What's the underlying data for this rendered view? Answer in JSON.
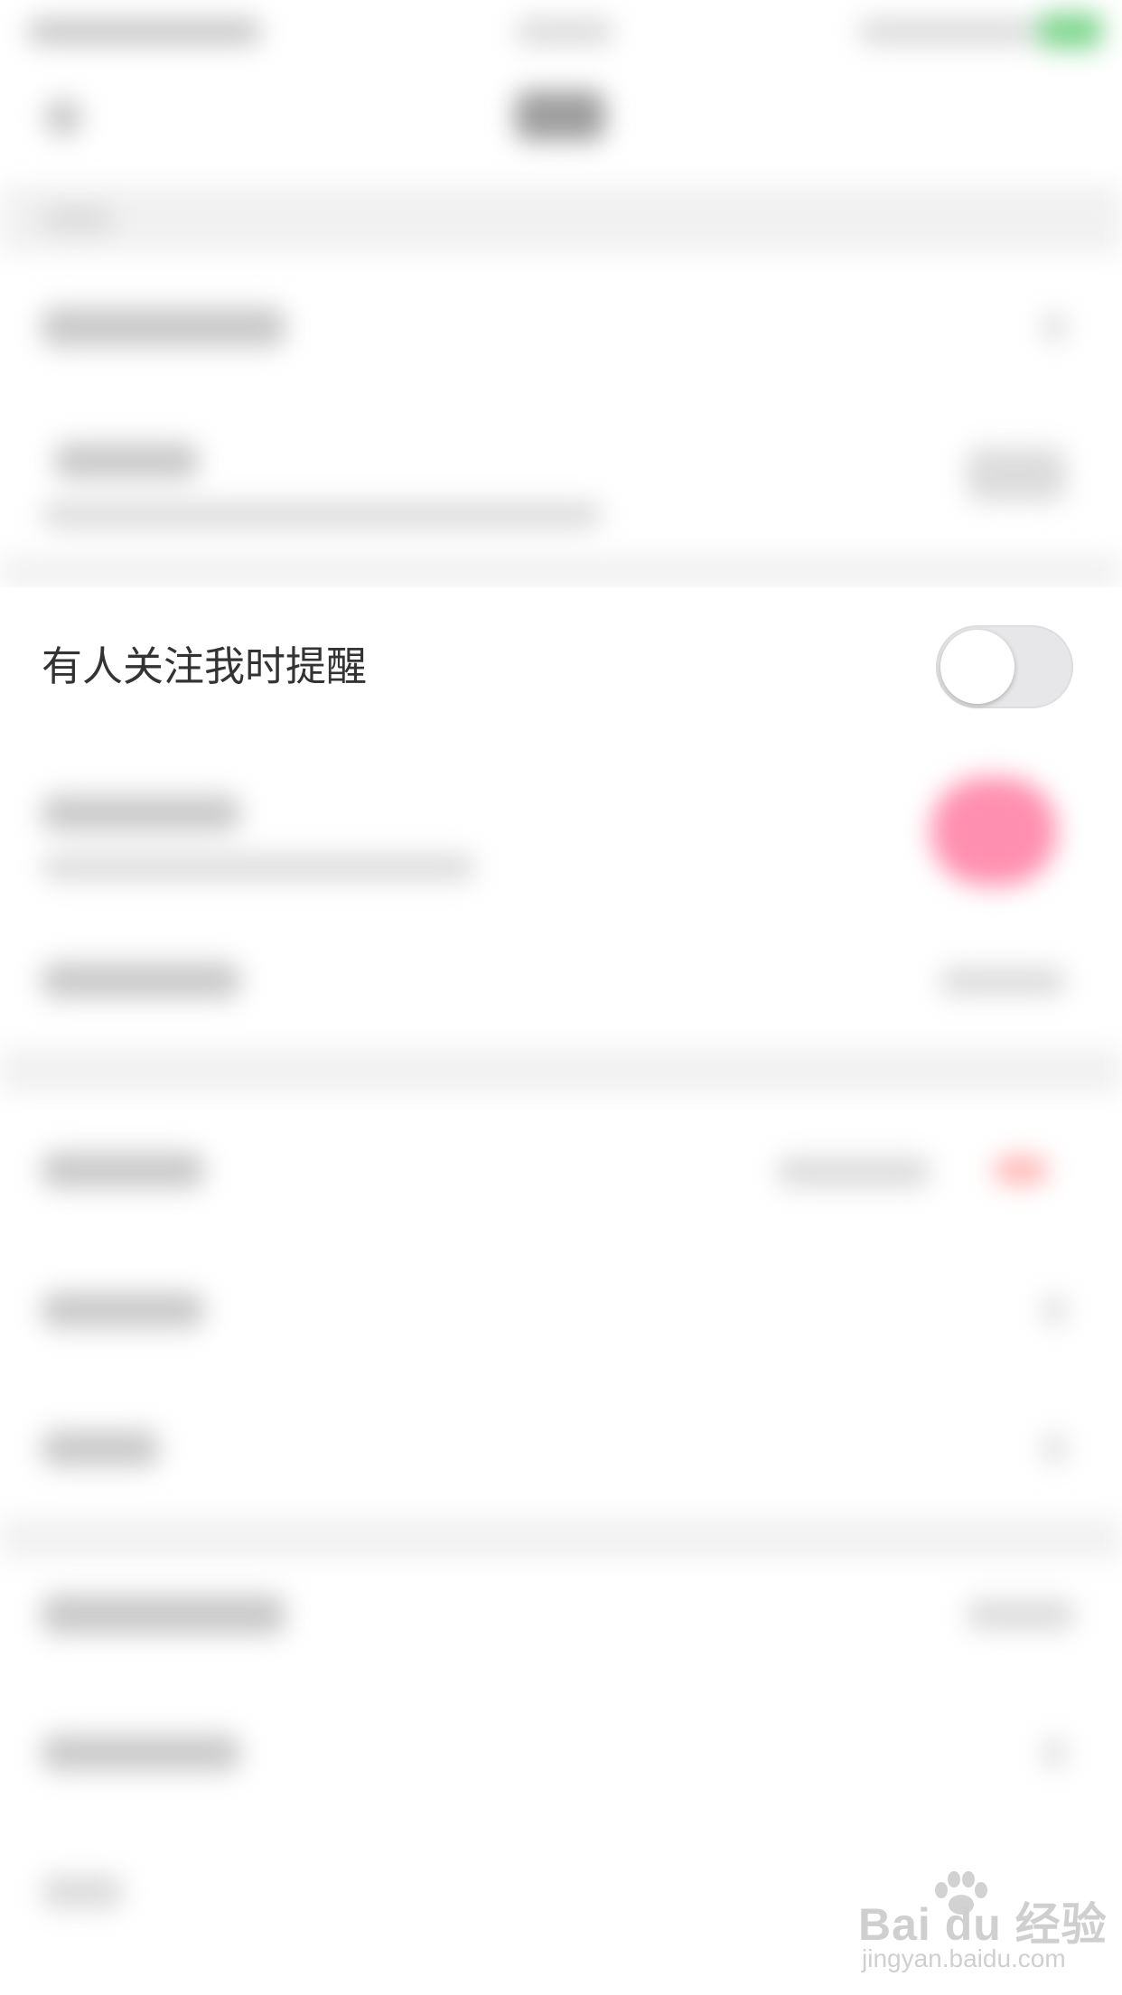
{
  "focus_setting": {
    "label": "有人关注我时提醒",
    "toggle_on": false
  },
  "colors": {
    "accent_pink": "#ff8fb0",
    "status_green": "#4cd964",
    "toggle_track_off": "#e7e7e9"
  },
  "watermark": {
    "main": "Bai du 经验",
    "sub": "jingyan.baidu.com"
  }
}
